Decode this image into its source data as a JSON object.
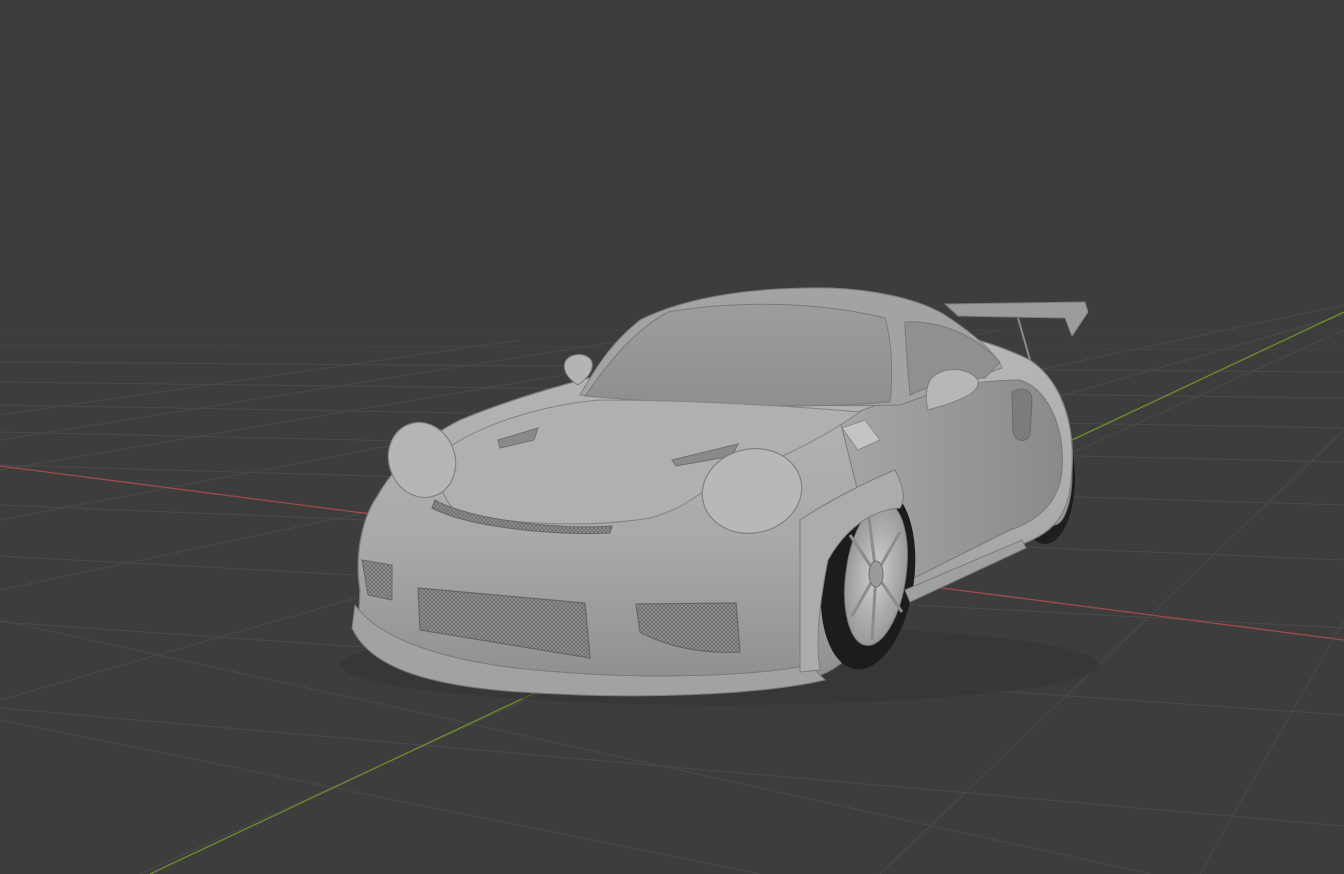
{
  "viewport": {
    "mode": "solid-shading",
    "background_color": "#3d3d3d",
    "grid": true,
    "axis_colors": {
      "x_axis": "#a04a4e",
      "y_axis": "#6f8f2a"
    },
    "object": {
      "kind": "car-model",
      "color": "#b4b4b4"
    }
  }
}
